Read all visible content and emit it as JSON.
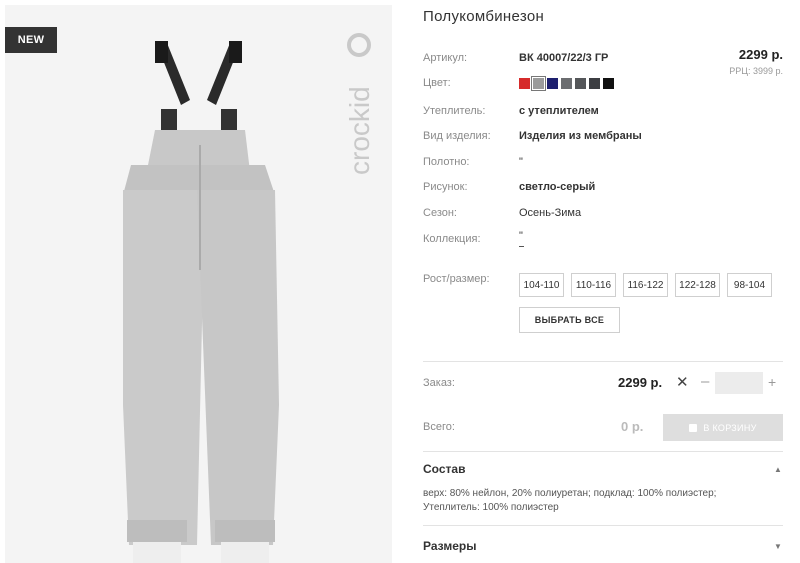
{
  "badge": "NEW",
  "brand": "crockid",
  "title": "Полукомбинезон",
  "price": {
    "main": "2299 р.",
    "rrp": "РРЦ: 3999 р."
  },
  "attributes": [
    {
      "label": "Артикул:",
      "value": "ВК 40007/22/3 ГР",
      "bold": true
    },
    {
      "label": "Цвет:",
      "value": ""
    },
    {
      "label": "Утеплитель:",
      "value": "с утеплителем",
      "bold": true
    },
    {
      "label": "Вид изделия:",
      "value": "Изделия из мембраны",
      "bold": true
    },
    {
      "label": "Полотно:",
      "value": "\"",
      "bold": false
    },
    {
      "label": "Рисунок:",
      "value": "светло-серый",
      "bold": true
    },
    {
      "label": "Сезон:",
      "value": "Осень-Зима",
      "bold": false
    },
    {
      "label": "Коллекция:",
      "value": "\"",
      "bold": false
    }
  ],
  "colors": [
    "#d62b2b",
    "#9b9b9b",
    "#1d1f6e",
    "#6b6d70",
    "#545659",
    "#3c3e42",
    "#111111"
  ],
  "size_label": "Рост/размер:",
  "sizes": [
    "104-110",
    "110-116",
    "116-122",
    "122-128",
    "98-104"
  ],
  "select_all": "ВЫБРАТЬ ВСЕ",
  "order": {
    "label": "Заказ:",
    "price": "2299 р.",
    "times": "✕",
    "minus": "–",
    "plus": "+",
    "qty": ""
  },
  "total": {
    "label": "Всего:",
    "value": "0 р."
  },
  "cart_button": "В КОРЗИНУ",
  "composition": {
    "title": "Состав",
    "line1": "верх: 80% нейлон, 20% полиуретан; подклад: 100% полиэстер;",
    "line2": "Утеплитель: 100% полиэстер"
  },
  "sizes_section": {
    "title": "Размеры"
  }
}
